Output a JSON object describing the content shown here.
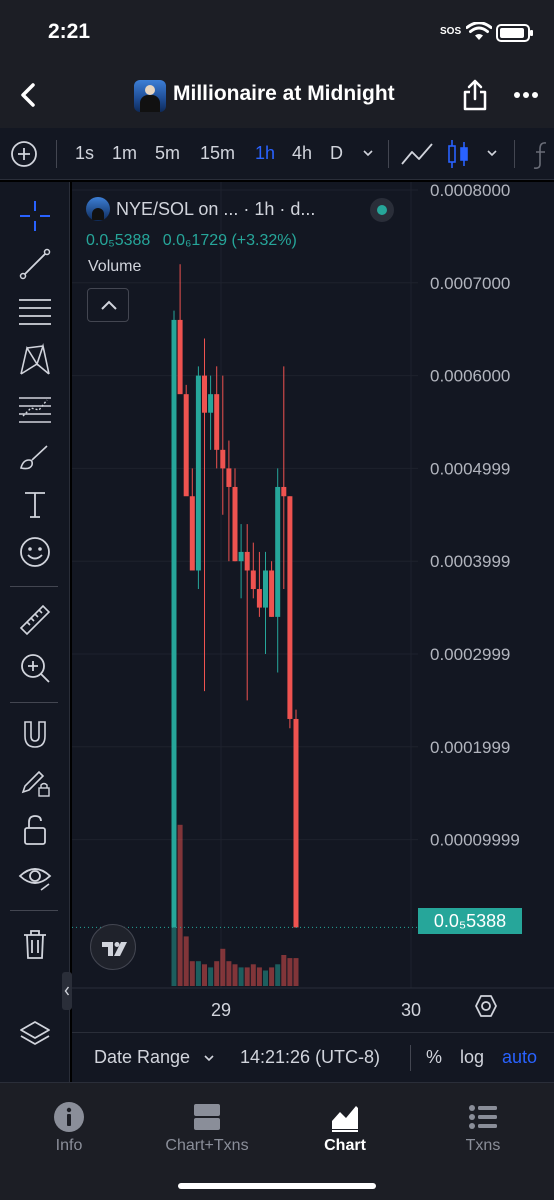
{
  "status_bar": {
    "time": "2:21",
    "sos": "SOS"
  },
  "header": {
    "title": "Millionaire at Midnight",
    "icons": [
      "back-icon",
      "share-icon",
      "more-icon"
    ]
  },
  "toolbar": {
    "intervals": [
      "1s",
      "1m",
      "5m",
      "15m",
      "1h",
      "4h",
      "D"
    ],
    "active_interval": "1h",
    "icons": [
      "add-icon",
      "chevron-down-icon",
      "line-chart-icon",
      "candlestick-icon",
      "indicators-icon"
    ]
  },
  "left_tools": [
    "crosshair-icon",
    "trend-line-icon",
    "fib-retracement-icon",
    "pattern-icon",
    "projection-icon",
    "brush-icon",
    "text-icon",
    "emoji-icon",
    "ruler-icon",
    "zoom-in-icon",
    "magnet-icon",
    "lock-drawing-icon",
    "unlock-icon",
    "eye-icon",
    "trash-icon",
    "layers-icon"
  ],
  "chart": {
    "legend_title": "NYE/SOL on ... · 1h · d...",
    "legend_price": "0.0₅5388",
    "legend_change": "0.0₆1729 (+3.32%)",
    "volume_label": "Volume",
    "current_price_tag": "0.0₅5388",
    "x_tick_29": "29",
    "x_tick_30": "30",
    "date_range": "Date Range",
    "time": "14:21:26 (UTC-8)",
    "pct_label": "%",
    "log_label": "log",
    "auto_label": "auto"
  },
  "chart_data": {
    "type": "candlestick",
    "pair": "NYE/SOL",
    "interval": "1h",
    "y_axis_labels": [
      "0.0008000",
      "0.0007000",
      "0.0006000",
      "0.0004999",
      "0.0003999",
      "0.0002999",
      "0.0001999",
      "0.00009999"
    ],
    "ylim": [
      5.4e-06,
      0.00081
    ],
    "x_tick_labels": [
      "29",
      "30"
    ],
    "candles": [
      {
        "o": 5.4e-06,
        "h": 0.00067,
        "l": 5.4e-06,
        "c": 0.00066
      },
      {
        "o": 0.00066,
        "h": 0.00072,
        "l": 0.0006,
        "c": 0.00058
      },
      {
        "o": 0.00058,
        "h": 0.00059,
        "l": 0.00049,
        "c": 0.00047
      },
      {
        "o": 0.00047,
        "h": 0.0005,
        "l": 0.00041,
        "c": 0.00039
      },
      {
        "o": 0.00039,
        "h": 0.00061,
        "l": 0.00037,
        "c": 0.0006
      },
      {
        "o": 0.0006,
        "h": 0.00064,
        "l": 0.00026,
        "c": 0.00056
      },
      {
        "o": 0.00056,
        "h": 0.0006,
        "l": 0.00052,
        "c": 0.00058
      },
      {
        "o": 0.00058,
        "h": 0.00061,
        "l": 0.0005,
        "c": 0.00052
      },
      {
        "o": 0.00052,
        "h": 0.0006,
        "l": 0.00045,
        "c": 0.0005
      },
      {
        "o": 0.0005,
        "h": 0.00053,
        "l": 0.0004,
        "c": 0.00048
      },
      {
        "o": 0.00048,
        "h": 0.0005,
        "l": 0.0004,
        "c": 0.0004
      },
      {
        "o": 0.0004,
        "h": 0.00044,
        "l": 0.00036,
        "c": 0.00041
      },
      {
        "o": 0.00041,
        "h": 0.00044,
        "l": 0.00025,
        "c": 0.00039
      },
      {
        "o": 0.00039,
        "h": 0.00042,
        "l": 0.00036,
        "c": 0.00037
      },
      {
        "o": 0.00037,
        "h": 0.00041,
        "l": 0.00034,
        "c": 0.00035
      },
      {
        "o": 0.00035,
        "h": 0.00041,
        "l": 0.0003,
        "c": 0.00039
      },
      {
        "o": 0.00039,
        "h": 0.0004,
        "l": 0.00034,
        "c": 0.00034
      },
      {
        "o": 0.00034,
        "h": 0.0005,
        "l": 0.00028,
        "c": 0.00048
      },
      {
        "o": 0.00048,
        "h": 0.00061,
        "l": 0.00037,
        "c": 0.00047
      },
      {
        "o": 0.00047,
        "h": 0.00047,
        "l": 0.00022,
        "c": 0.00023
      },
      {
        "o": 0.00023,
        "h": 0.00024,
        "l": 5.2e-06,
        "c": 5.4e-06
      }
    ],
    "volumes": [
      1.0,
      2.6,
      0.8,
      0.4,
      0.4,
      0.35,
      0.3,
      0.4,
      0.6,
      0.4,
      0.35,
      0.3,
      0.3,
      0.35,
      0.3,
      0.25,
      0.3,
      0.35,
      0.5,
      0.45,
      0.45
    ],
    "current_price": "0.0₅5388",
    "grid": true
  },
  "tabs": [
    {
      "label": "Info",
      "icon": "info-icon"
    },
    {
      "label": "Chart+Txns",
      "icon": "split-view-icon"
    },
    {
      "label": "Chart",
      "icon": "area-chart-icon",
      "active": true
    },
    {
      "label": "Txns",
      "icon": "list-icon"
    }
  ],
  "colors": {
    "up": "#26a69a",
    "down": "#ef5350",
    "accent": "#2962ff",
    "background": "#131722"
  }
}
